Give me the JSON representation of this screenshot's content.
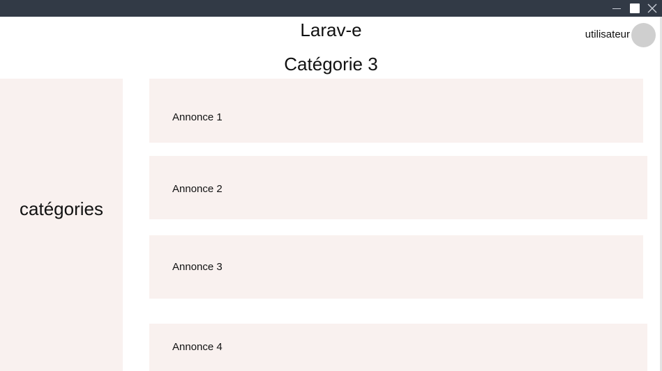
{
  "app": {
    "title": "Larav-e"
  },
  "header": {
    "user_label": "utilisateur"
  },
  "page": {
    "title": "Catégorie 3"
  },
  "sidebar": {
    "label": "catégories"
  },
  "annonces": [
    {
      "label": "Annonce 1"
    },
    {
      "label": "Annonce 2"
    },
    {
      "label": "Annonce 3"
    },
    {
      "label": "Annonce 4"
    }
  ],
  "colors": {
    "titlebar": "#323a46",
    "panel": "#f9f1ef",
    "avatar": "#cfcfcf"
  }
}
